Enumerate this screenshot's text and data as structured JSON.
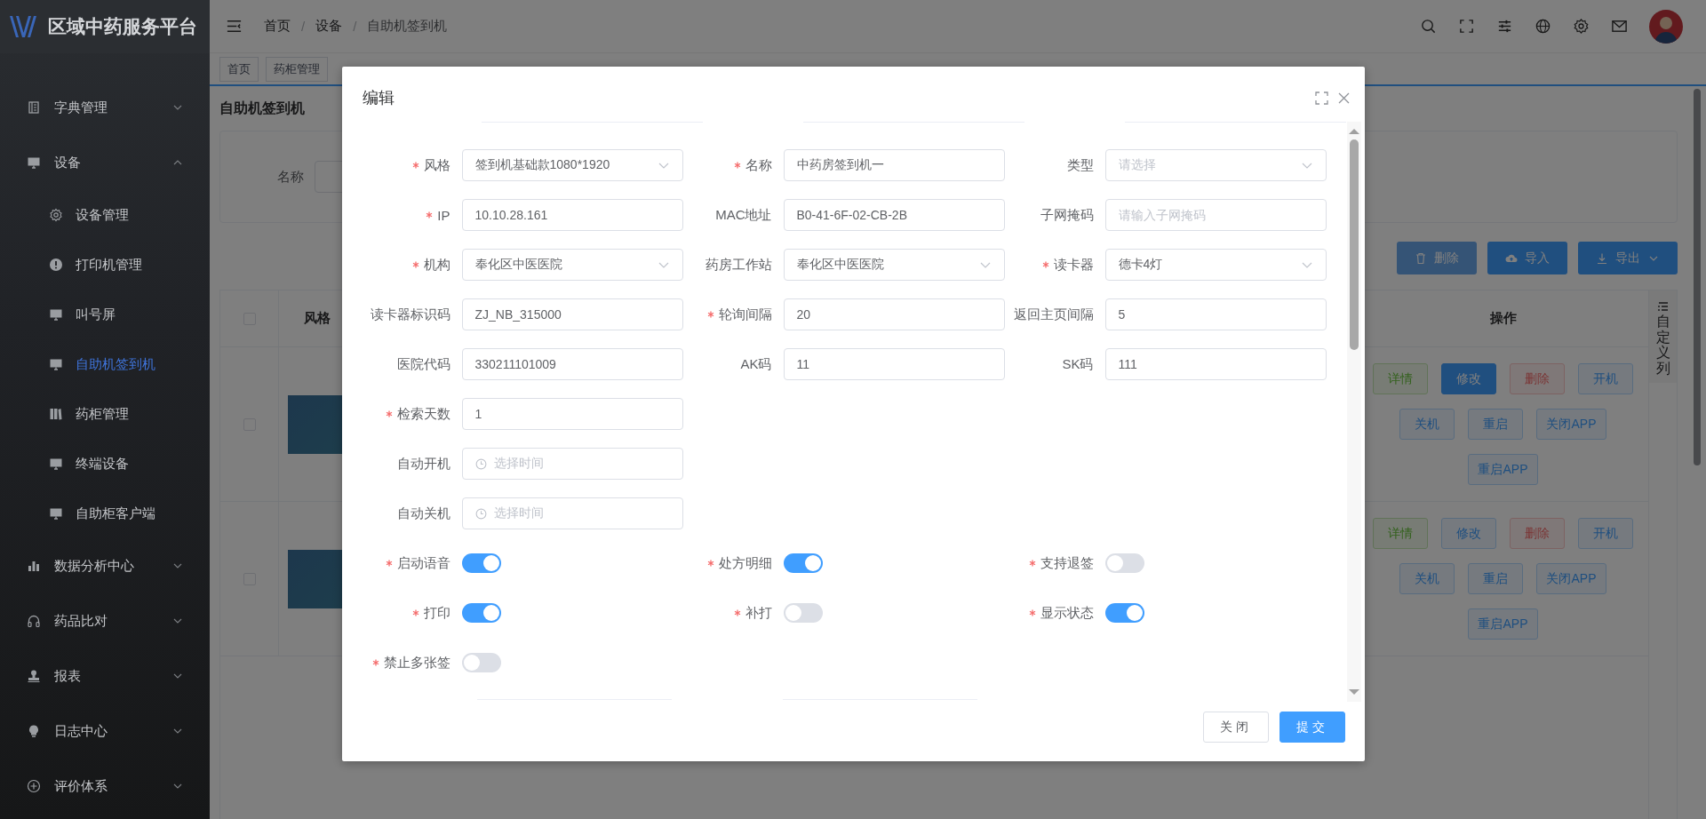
{
  "sidebar": {
    "title": "区域中药服务平台",
    "items": [
      {
        "label": "字典管理",
        "kind": "book",
        "expanded": false
      },
      {
        "label": "设备",
        "kind": "monitor",
        "expanded": true,
        "children": [
          {
            "label": "设备管理",
            "kind": "gear",
            "selected": false
          },
          {
            "label": "打印机管理",
            "kind": "alert",
            "selected": false
          },
          {
            "label": "叫号屏",
            "kind": "monitor",
            "selected": false
          },
          {
            "label": "自助机签到机",
            "kind": "monitor",
            "selected": true
          },
          {
            "label": "药柜管理",
            "kind": "cabinet",
            "selected": false
          },
          {
            "label": "终端设备",
            "kind": "monitor",
            "selected": false
          },
          {
            "label": "自助柜客户端",
            "kind": "monitor",
            "selected": false
          }
        ]
      },
      {
        "label": "数据分析中心",
        "kind": "chart",
        "expanded": false
      },
      {
        "label": "药品比对",
        "kind": "headset",
        "expanded": false
      },
      {
        "label": "报表",
        "kind": "stamp",
        "expanded": false
      },
      {
        "label": "日志中心",
        "kind": "bulb",
        "expanded": false
      },
      {
        "label": "评价体系",
        "kind": "plus",
        "expanded": false
      }
    ]
  },
  "header": {
    "breadcrumb": [
      "首页",
      "设备",
      "自助机签到机"
    ],
    "separator": "/"
  },
  "tabs": [
    {
      "label": "首页",
      "selected": false
    },
    {
      "label": "药柜管理",
      "selected": false
    }
  ],
  "page": {
    "title": "自助机签到机",
    "search": {
      "label": "名称"
    },
    "toolbar": [
      {
        "label": "删除",
        "kind": "delete",
        "disabled": true
      },
      {
        "label": "导入",
        "kind": "import",
        "disabled": false
      },
      {
        "label": "导出",
        "kind": "export",
        "disabled": false
      }
    ],
    "table": {
      "header_checked": false,
      "columns": [
        "风格",
        "操作"
      ],
      "custom_columns": "自定义列",
      "rows": [
        {
          "checked": false,
          "actions": [
            {
              "label": "详情",
              "kind": "success"
            },
            {
              "label": "修改",
              "kind": "primary"
            },
            {
              "label": "删除",
              "kind": "danger"
            },
            {
              "label": "开机",
              "kind": "plain"
            },
            {
              "label": "关机",
              "kind": "plain"
            },
            {
              "label": "重启",
              "kind": "plain"
            },
            {
              "label": "关闭APP",
              "kind": "plain"
            },
            {
              "label": "重启APP",
              "kind": "plain"
            }
          ]
        },
        {
          "checked": false,
          "actions": [
            {
              "label": "详情",
              "kind": "success"
            },
            {
              "label": "修改",
              "kind": "plain"
            },
            {
              "label": "删除",
              "kind": "danger"
            },
            {
              "label": "开机",
              "kind": "plain"
            },
            {
              "label": "关机",
              "kind": "plain"
            },
            {
              "label": "重启",
              "kind": "plain"
            },
            {
              "label": "关闭APP",
              "kind": "plain"
            },
            {
              "label": "重启APP",
              "kind": "plain"
            }
          ]
        }
      ]
    }
  },
  "dialog": {
    "title": "编辑",
    "rows": [
      [
        {
          "label": "风格",
          "required": true,
          "kind": "select",
          "value": "签到机基础款1080*1920"
        },
        {
          "label": "名称",
          "required": true,
          "kind": "input",
          "value": "中药房签到机一"
        },
        {
          "label": "类型",
          "required": false,
          "kind": "select",
          "placeholder": "请选择"
        }
      ],
      [
        {
          "label": "IP",
          "required": true,
          "kind": "input",
          "value": "10.10.28.161"
        },
        {
          "label": "MAC地址",
          "required": false,
          "kind": "input",
          "value": "B0-41-6F-02-CB-2B"
        },
        {
          "label": "子网掩码",
          "required": false,
          "kind": "input",
          "placeholder": "请输入子网掩码"
        }
      ],
      [
        {
          "label": "机构",
          "required": true,
          "kind": "select",
          "value": "奉化区中医医院"
        },
        {
          "label": "药房工作站",
          "required": false,
          "kind": "select",
          "value": "奉化区中医医院"
        },
        {
          "label": "读卡器",
          "required": true,
          "kind": "select",
          "value": "德卡4灯"
        }
      ],
      [
        {
          "label": "读卡器标识码",
          "required": false,
          "kind": "input",
          "value": "ZJ_NB_315000"
        },
        {
          "label": "轮询间隔",
          "required": true,
          "kind": "input",
          "value": "20"
        },
        {
          "label": "返回主页间隔",
          "required": false,
          "kind": "input",
          "value": "5"
        }
      ],
      [
        {
          "label": "医院代码",
          "required": false,
          "kind": "input",
          "value": "330211101009"
        },
        {
          "label": "AK码",
          "required": false,
          "kind": "input",
          "value": "11"
        },
        {
          "label": "SK码",
          "required": false,
          "kind": "input",
          "value": "111"
        }
      ],
      [
        {
          "label": "检索天数",
          "required": true,
          "kind": "input",
          "value": "1"
        }
      ],
      [
        {
          "label": "自动开机",
          "required": false,
          "kind": "time",
          "placeholder": "选择时间"
        }
      ],
      [
        {
          "label": "自动关机",
          "required": false,
          "kind": "time",
          "placeholder": "选择时间"
        }
      ],
      [
        {
          "label": "启动语音",
          "required": true,
          "kind": "switch",
          "on": true
        },
        {
          "label": "处方明细",
          "required": true,
          "kind": "switch",
          "on": true
        },
        {
          "label": "支持退签",
          "required": true,
          "kind": "switch",
          "on": false
        }
      ],
      [
        {
          "label": "打印",
          "required": true,
          "kind": "switch",
          "on": true
        },
        {
          "label": "补打",
          "required": true,
          "kind": "switch",
          "on": false
        },
        {
          "label": "显示状态",
          "required": true,
          "kind": "switch",
          "on": true
        }
      ],
      [
        {
          "label": "禁止多张签",
          "required": true,
          "kind": "switch",
          "on": false
        }
      ]
    ],
    "buttons": [
      {
        "label": "关闭",
        "kind": "default"
      },
      {
        "label": "提交",
        "kind": "primary"
      }
    ]
  }
}
